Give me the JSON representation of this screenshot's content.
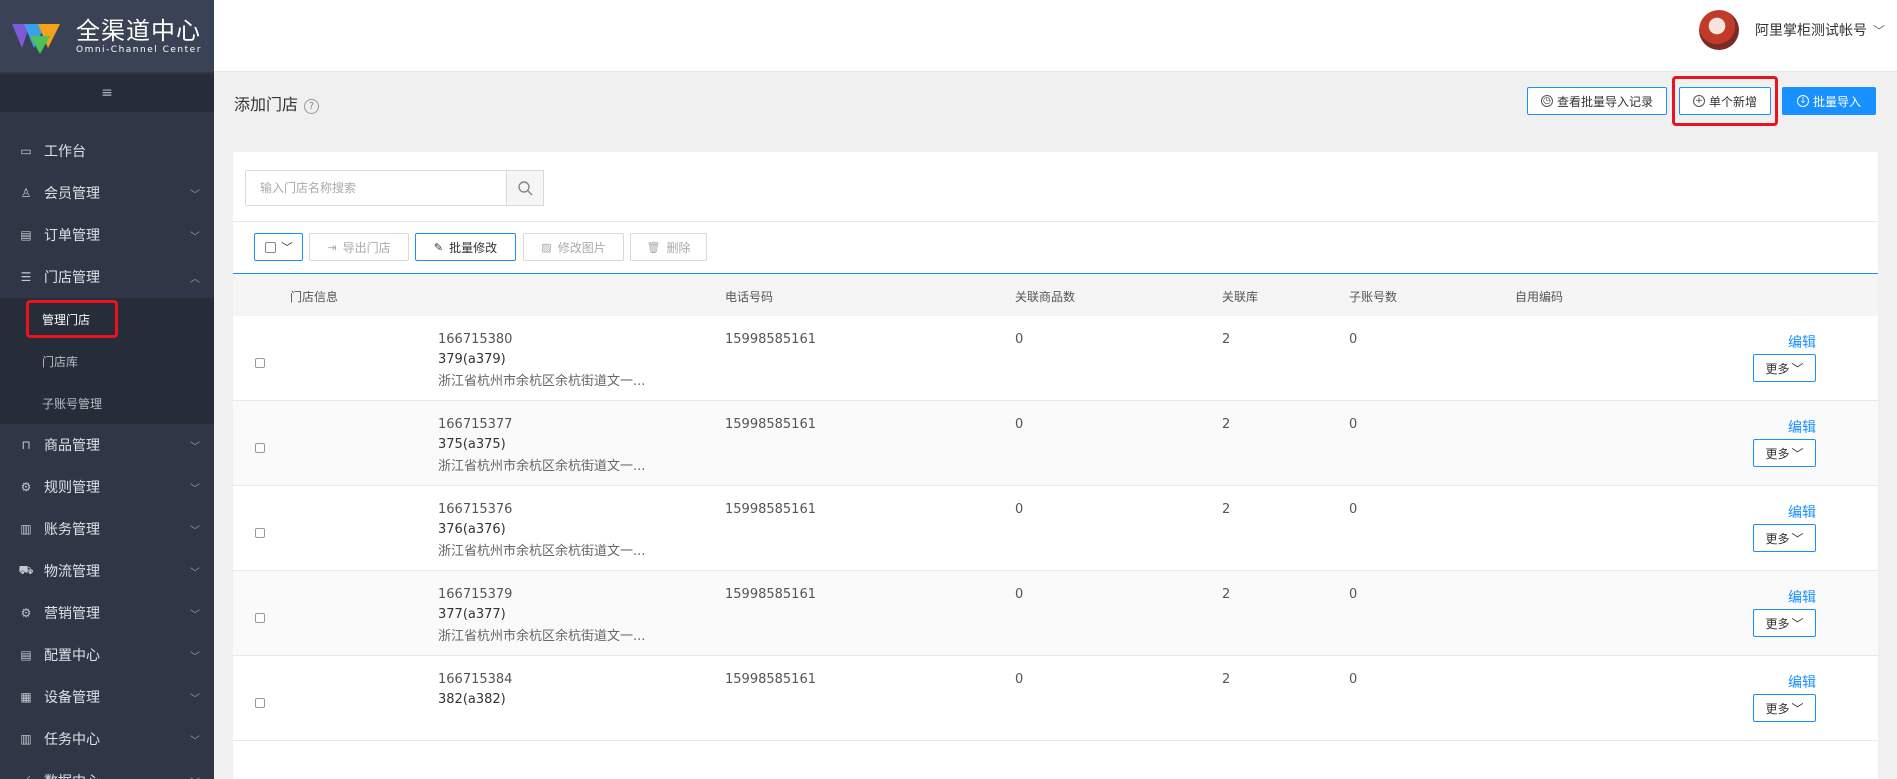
{
  "brand": {
    "name_cn": "全渠道中心",
    "name_en": "Omni-Channel Center"
  },
  "sidebar": {
    "collapse_icon": "≡",
    "items": [
      {
        "label": "工作台",
        "icon": "monitor-icon",
        "glyph": "▭",
        "expandable": false
      },
      {
        "label": "会员管理",
        "icon": "users-icon",
        "glyph": "♙",
        "expandable": true
      },
      {
        "label": "订单管理",
        "icon": "order-icon",
        "glyph": "▤",
        "expandable": true
      },
      {
        "label": "门店管理",
        "icon": "list-icon",
        "glyph": "☰",
        "expandable": true,
        "expanded": true
      },
      {
        "label": "商品管理",
        "icon": "bag-icon",
        "glyph": "⊓",
        "expandable": true
      },
      {
        "label": "规则管理",
        "icon": "rule-icon",
        "glyph": "⚙",
        "expandable": true
      },
      {
        "label": "账务管理",
        "icon": "account-icon",
        "glyph": "▥",
        "expandable": true
      },
      {
        "label": "物流管理",
        "icon": "truck-icon",
        "glyph": "⛟",
        "expandable": true
      },
      {
        "label": "营销管理",
        "icon": "marketing-icon",
        "glyph": "⚙",
        "expandable": true
      },
      {
        "label": "配置中心",
        "icon": "config-icon",
        "glyph": "▤",
        "expandable": true
      },
      {
        "label": "设备管理",
        "icon": "grid-icon",
        "glyph": "▦",
        "expandable": true
      },
      {
        "label": "任务中心",
        "icon": "task-icon",
        "glyph": "▥",
        "expandable": true
      },
      {
        "label": "数据中心",
        "icon": "chart-icon",
        "glyph": "⟋",
        "expandable": true
      }
    ],
    "store_submenu": [
      "管理门店",
      "门店库",
      "子账号管理"
    ]
  },
  "header": {
    "user_name": "阿里掌柜测试帐号"
  },
  "page": {
    "title": "添加门店",
    "actions": {
      "view_import_records": "查看批量导入记录",
      "single_add": "单个新增",
      "batch_import": "批量导入"
    }
  },
  "search": {
    "placeholder": "输入门店名称搜索"
  },
  "toolbar": {
    "export": "导出门店",
    "batch_edit": "批量修改",
    "edit_image": "修改图片",
    "delete": "删除"
  },
  "table": {
    "columns": [
      "门店信息",
      "电话号码",
      "关联商品数",
      "关联库",
      "子账号数",
      "自用编码"
    ],
    "edit_label": "编辑",
    "more_label": "更多",
    "rows": [
      {
        "id": "166715380",
        "name": "379(a379)",
        "address": "浙江省杭州市余杭区余杭街道文一...",
        "phone": "15998585161",
        "goods": "0",
        "lib": "2",
        "sub": "0"
      },
      {
        "id": "166715377",
        "name": "375(a375)",
        "address": "浙江省杭州市余杭区余杭街道文一...",
        "phone": "15998585161",
        "goods": "0",
        "lib": "2",
        "sub": "0"
      },
      {
        "id": "166715376",
        "name": "376(a376)",
        "address": "浙江省杭州市余杭区余杭街道文一...",
        "phone": "15998585161",
        "goods": "0",
        "lib": "2",
        "sub": "0"
      },
      {
        "id": "166715379",
        "name": "377(a377)",
        "address": "浙江省杭州市余杭区余杭街道文一...",
        "phone": "15998585161",
        "goods": "0",
        "lib": "2",
        "sub": "0"
      },
      {
        "id": "166715384",
        "name": "382(a382)",
        "address": "",
        "phone": "15998585161",
        "goods": "0",
        "lib": "2",
        "sub": "0"
      }
    ]
  },
  "colors": {
    "sidebar_bg": "#2f3645",
    "accent": "#1890ff",
    "highlight": "#e8151f"
  }
}
